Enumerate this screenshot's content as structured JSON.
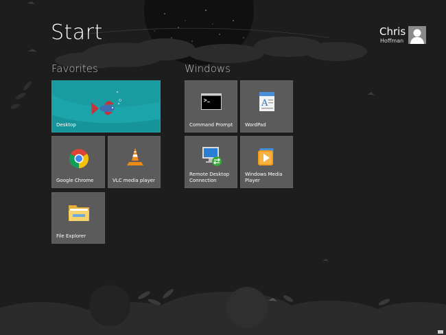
{
  "screen": {
    "title": "Start"
  },
  "user": {
    "first_name": "Chris",
    "last_name": "Hoffman",
    "avatar_icon": "user-avatar-icon"
  },
  "groups": {
    "favorites": "Favorites",
    "windows": "Windows"
  },
  "tiles": {
    "desktop": {
      "label": "Desktop",
      "icon": "betta-fish-wallpaper"
    },
    "chrome": {
      "label": "Google Chrome",
      "icon": "chrome-icon"
    },
    "vlc": {
      "label": "VLC media player",
      "icon": "vlc-cone-icon"
    },
    "file_explorer": {
      "label": "File Explorer",
      "icon": "folder-icon"
    },
    "command_prompt": {
      "label": "Command Prompt",
      "icon": "command-prompt-icon"
    },
    "wordpad": {
      "label": "WordPad",
      "icon": "wordpad-icon"
    },
    "remote_desktop": {
      "label": "Remote Desktop Connection",
      "icon": "remote-desktop-icon"
    },
    "media_player": {
      "label": "Windows Media Player",
      "icon": "media-player-icon"
    }
  },
  "colors": {
    "background": "#1d1d1d",
    "tile_gray": "#5b5b5b",
    "desktop_tile": "#1a9aa1"
  }
}
